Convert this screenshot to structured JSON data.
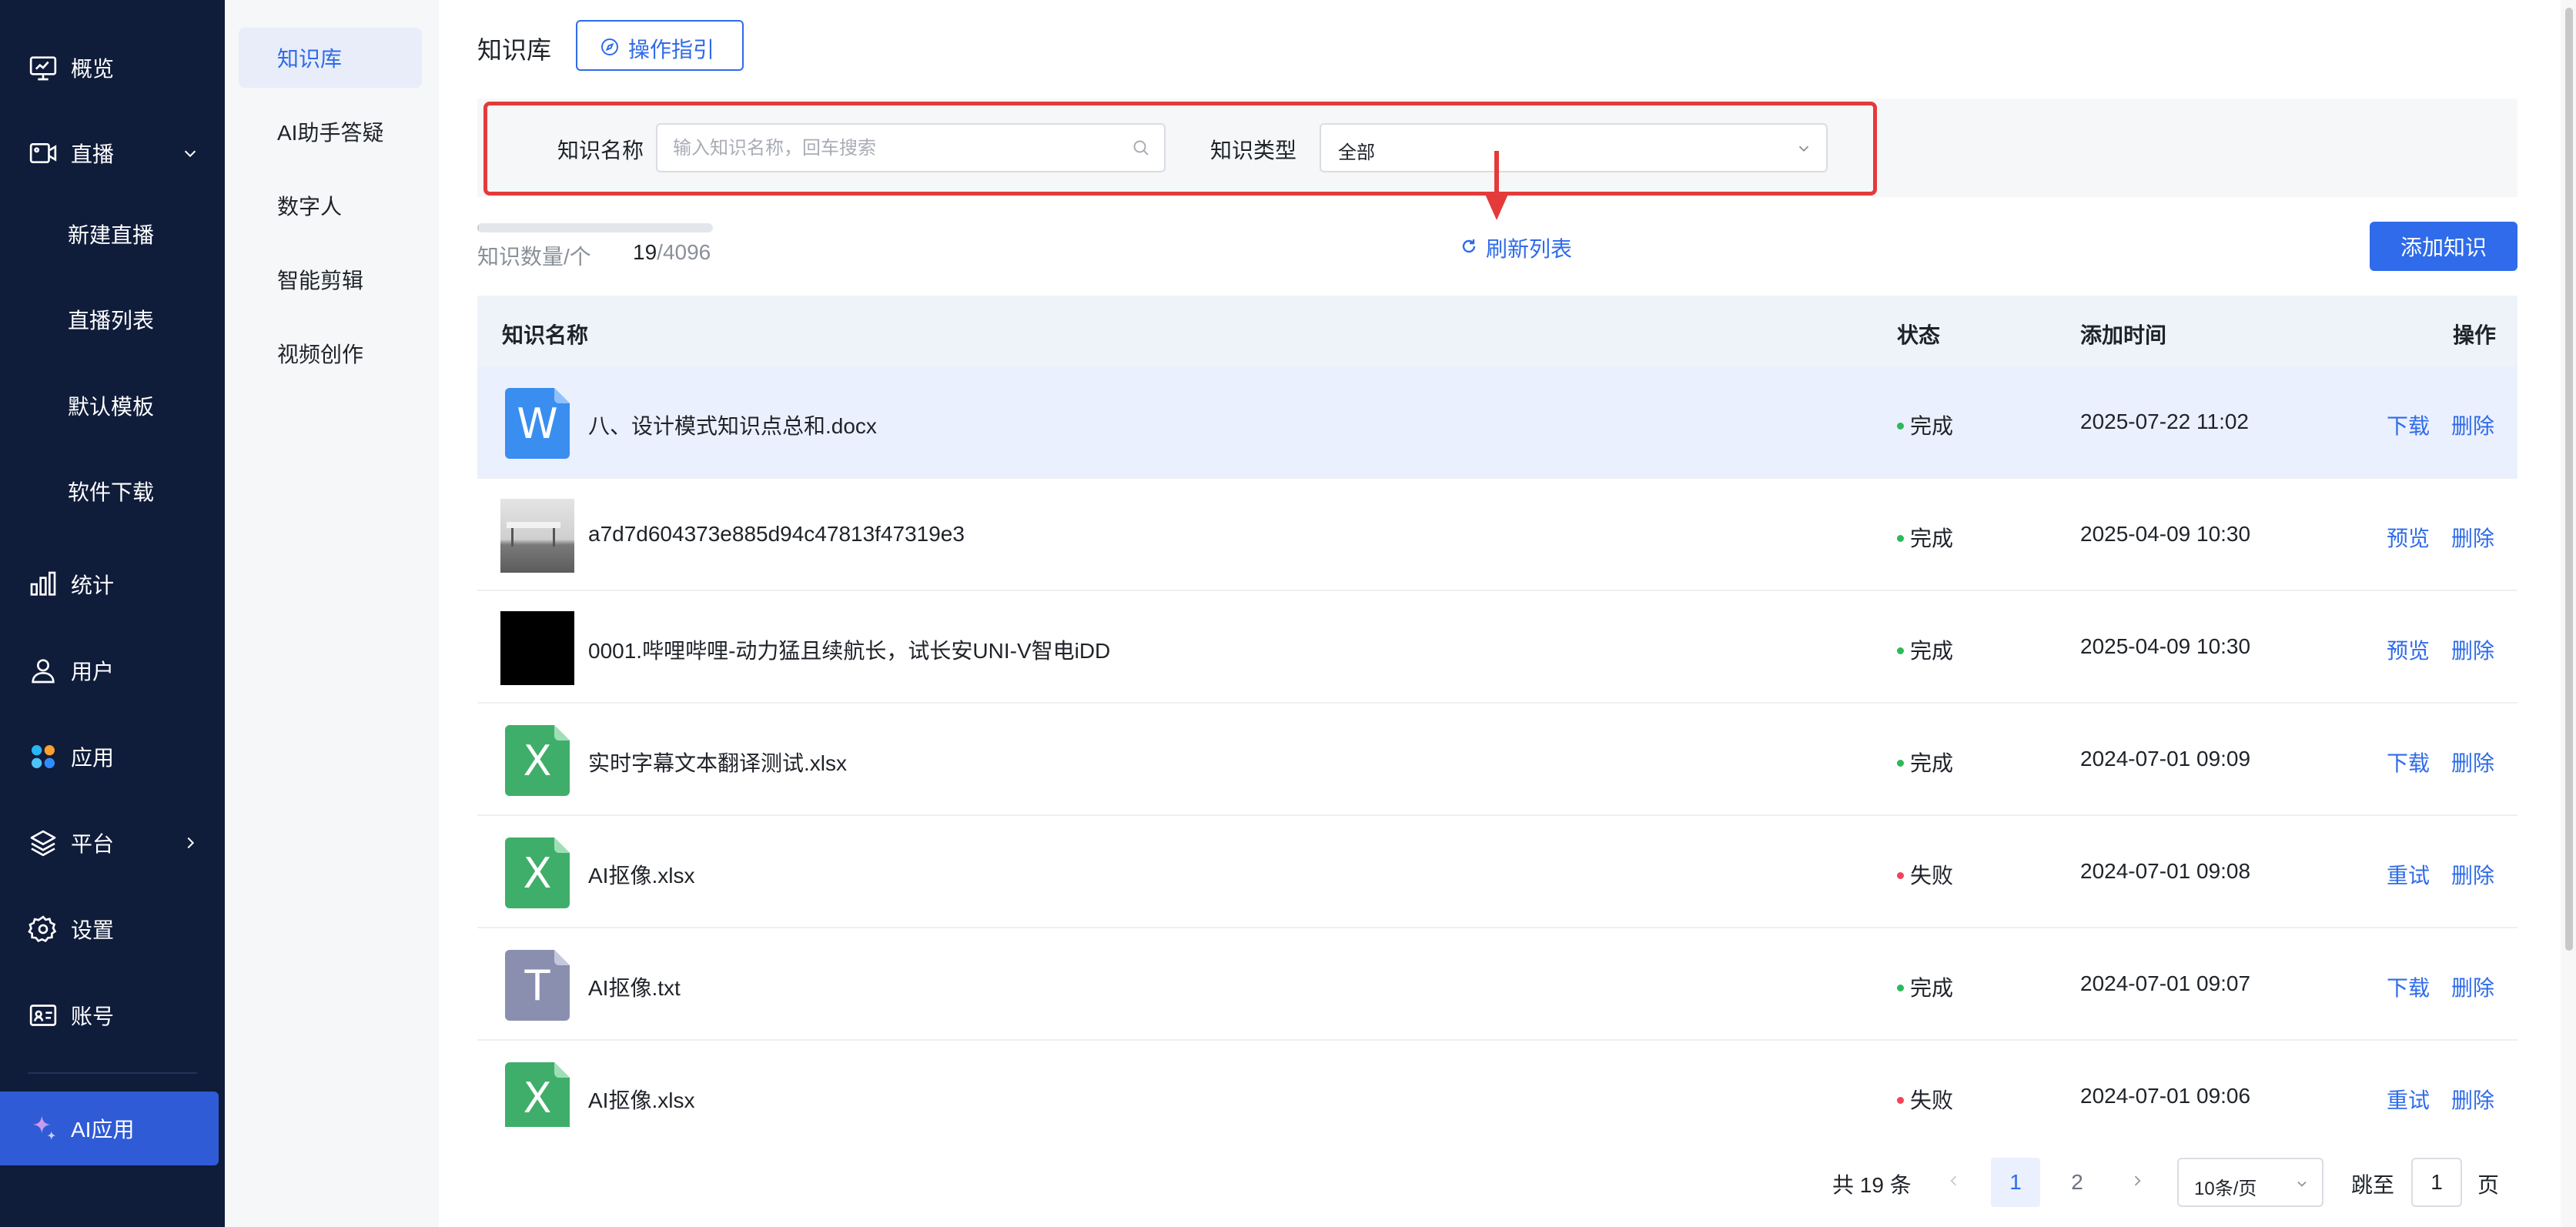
{
  "sidebar": {
    "items": [
      {
        "label": "概览",
        "icon": "monitor-icon"
      },
      {
        "label": "直播",
        "icon": "live-icon",
        "chevron": "down"
      },
      {
        "label": "新建直播"
      },
      {
        "label": "直播列表"
      },
      {
        "label": "默认模板"
      },
      {
        "label": "软件下载"
      },
      {
        "label": "统计",
        "icon": "bar-chart-icon"
      },
      {
        "label": "用户",
        "icon": "user-icon"
      },
      {
        "label": "应用",
        "icon": "apps-icon"
      },
      {
        "label": "平台",
        "icon": "layers-icon",
        "chevron": "right"
      },
      {
        "label": "设置",
        "icon": "gear-icon"
      },
      {
        "label": "账号",
        "icon": "id-card-icon"
      },
      {
        "label": "AI应用",
        "icon": "sparkle-icon",
        "active": true
      }
    ]
  },
  "submenu": {
    "items": [
      {
        "label": "知识库",
        "active": true
      },
      {
        "label": "AI助手答疑"
      },
      {
        "label": "数字人"
      },
      {
        "label": "智能剪辑"
      },
      {
        "label": "视频创作"
      }
    ]
  },
  "header": {
    "title": "知识库",
    "guide_label": "操作指引"
  },
  "filters": {
    "name_label": "知识名称",
    "name_placeholder": "输入知识名称，回车搜索",
    "type_label": "知识类型",
    "type_value": "全部"
  },
  "quota": {
    "label": "知识数量/个",
    "used": "19",
    "separator": "/",
    "total": "4096",
    "fraction": 0.005
  },
  "toolbar": {
    "refresh_label": "刷新列表",
    "add_label": "添加知识"
  },
  "table": {
    "columns": {
      "name": "知识名称",
      "status": "状态",
      "time": "添加时间",
      "actions": "操作"
    },
    "rows": [
      {
        "name": "八、设计模式知识点总和.docx",
        "type": "word",
        "icon_letter": "W",
        "status": "完成",
        "status_color": "#2eb85c",
        "time": "2025-07-22 11:02",
        "action1": "下载",
        "action2": "删除",
        "highlighted": true
      },
      {
        "name": "a7d7d604373e885d94c47813f47319e3",
        "type": "image",
        "status": "完成",
        "status_color": "#2eb85c",
        "time": "2025-04-09 10:30",
        "action1": "预览",
        "action2": "删除"
      },
      {
        "name": "0001.哔哩哔哩-动力猛且续航长，试长安UNI-V智电iDD",
        "type": "video",
        "status": "完成",
        "status_color": "#2eb85c",
        "time": "2025-04-09 10:30",
        "action1": "预览",
        "action2": "删除"
      },
      {
        "name": "实时字幕文本翻译测试.xlsx",
        "type": "excel",
        "icon_letter": "X",
        "status": "完成",
        "status_color": "#2eb85c",
        "time": "2024-07-01 09:09",
        "action1": "下载",
        "action2": "删除"
      },
      {
        "name": "AI抠像.xlsx",
        "type": "excel",
        "icon_letter": "X",
        "status": "失败",
        "status_color": "#f0445b",
        "time": "2024-07-01 09:08",
        "action1": "重试",
        "action2": "删除"
      },
      {
        "name": "AI抠像.txt",
        "type": "text",
        "icon_letter": "T",
        "status": "完成",
        "status_color": "#2eb85c",
        "time": "2024-07-01 09:07",
        "action1": "下载",
        "action2": "删除"
      },
      {
        "name": "AI抠像.xlsx",
        "type": "excel",
        "icon_letter": "X",
        "status": "失败",
        "status_color": "#f0445b",
        "time": "2024-07-01 09:06",
        "action1": "重试",
        "action2": "删除"
      }
    ]
  },
  "pagination": {
    "total_label": "共 19 条",
    "pages": [
      "1",
      "2"
    ],
    "current": "1",
    "page_size": "10条/页",
    "jump_label": "跳至",
    "jump_value": "1",
    "page_unit": "页"
  },
  "colors": {
    "sidebar_bg": "#0f1c3a",
    "accent": "#2f6bea",
    "success": "#2eb85c",
    "error": "#f0445b",
    "annotation": "#e53a3a"
  }
}
